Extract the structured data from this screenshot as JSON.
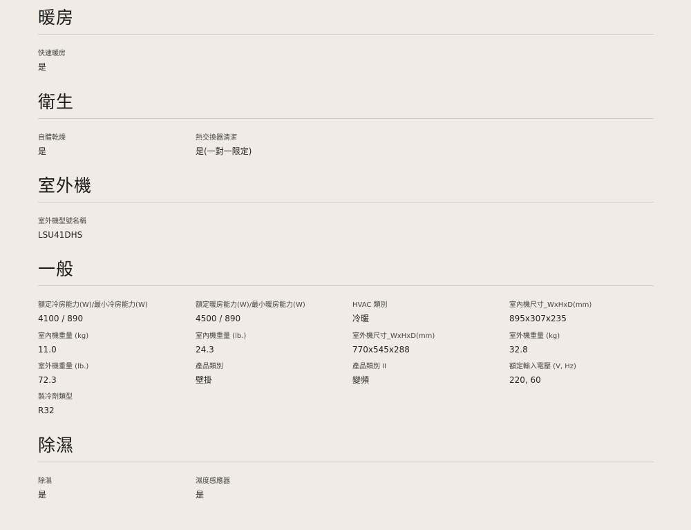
{
  "sections": {
    "heating": {
      "title": "暖房",
      "specs": [
        {
          "label": "快速暖房",
          "value": "是"
        }
      ]
    },
    "hygiene": {
      "title": "衛生",
      "specs": [
        {
          "label": "自體乾燥",
          "value": "是"
        },
        {
          "label": "熱交換器清潔",
          "value": "是(一對一限定)"
        }
      ]
    },
    "outdoor": {
      "title": "室外機",
      "specs": [
        {
          "label": "室外機型號名稱",
          "value": "LSU41DHS"
        }
      ]
    },
    "general": {
      "title": "一般",
      "specs": [
        {
          "label": "額定冷房能力(W)/最小冷房能力(W)",
          "value": "4100 / 890"
        },
        {
          "label": "額定暖房能力(W)/最小暖房能力(W)",
          "value": "4500 / 890"
        },
        {
          "label": "HVAC 類別",
          "value": "冷暖"
        },
        {
          "label": "室內機尺寸_WxHxD(mm)",
          "value": "895x307x235"
        },
        {
          "label": "室內機重量 (kg)",
          "value": "11.0"
        },
        {
          "label": "室內機重量 (lb.)",
          "value": "24.3"
        },
        {
          "label": "室外機尺寸_WxHxD(mm)",
          "value": "770x545x288"
        },
        {
          "label": "室外機重量 (kg)",
          "value": "32.8"
        },
        {
          "label": "室外機重量 (lb.)",
          "value": "72.3"
        },
        {
          "label": "產品類別",
          "value": "壁掛"
        },
        {
          "label": "產品類別 II",
          "value": "變頻"
        },
        {
          "label": "額定輸入電壓 (V, Hz)",
          "value": "220, 60"
        },
        {
          "label": "製冷劑類型",
          "value": "R32"
        }
      ]
    },
    "dehumidify": {
      "title": "除濕",
      "specs": [
        {
          "label": "除濕",
          "value": "是"
        },
        {
          "label": "濕度感應器",
          "value": "是"
        }
      ]
    }
  }
}
